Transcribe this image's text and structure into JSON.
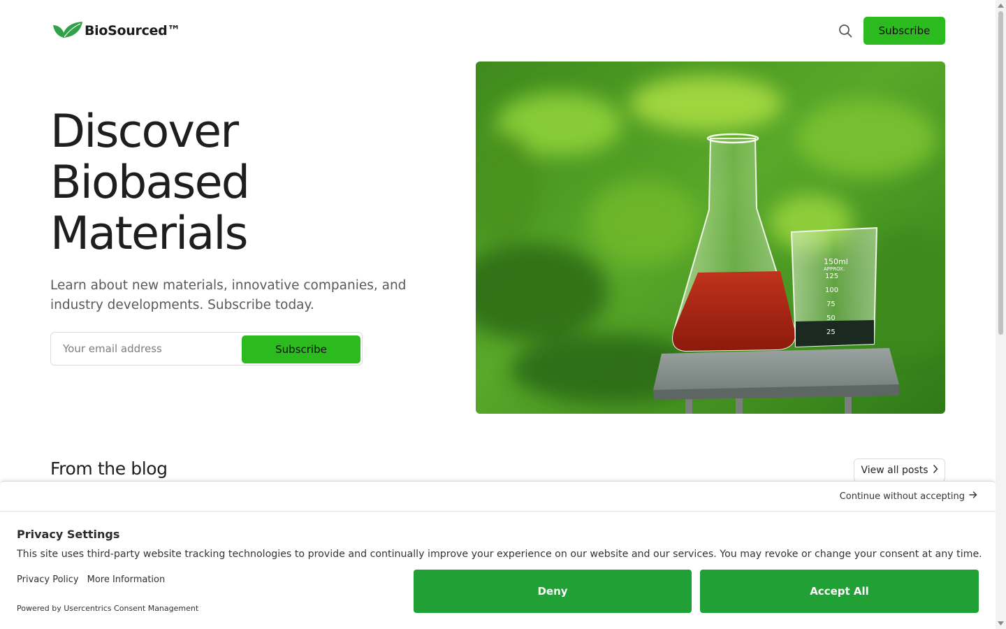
{
  "header": {
    "logo_text": "BioSourced™",
    "logo_icon": "leaf-icon",
    "search_icon": "search-icon",
    "subscribe_label": "Subscribe"
  },
  "hero": {
    "title_lines": [
      "Discover",
      "Biobased",
      "Materials"
    ],
    "subtitle": "Learn about new materials, innovative companies, and industry developments. Subscribe today.",
    "email_placeholder": "Your email address",
    "subscribe_label": "Subscribe",
    "image_labels": [
      "150ml",
      "APPROX.",
      "125",
      "100",
      "75",
      "50",
      "25"
    ]
  },
  "blog": {
    "title": "From the blog",
    "view_all_label": "View all posts",
    "view_all_icon": "chevron-right-icon"
  },
  "consent": {
    "continue_label": "Continue without accepting",
    "continue_icon": "arrow-right-icon",
    "title": "Privacy Settings",
    "text": "This site uses third-party website tracking technologies to provide and continually improve your experience on our website and our services. You may revoke or change your consent at any time.",
    "privacy_policy_label": "Privacy Policy",
    "more_info_label": "More Information",
    "powered_by": "Powered by Usercentrics Consent Management",
    "deny_label": "Deny",
    "accept_label": "Accept All"
  },
  "colors": {
    "brand_green": "#2cbb1e",
    "consent_green": "#21a135",
    "text_dark": "#1e1e1e",
    "text_muted": "#595959"
  }
}
